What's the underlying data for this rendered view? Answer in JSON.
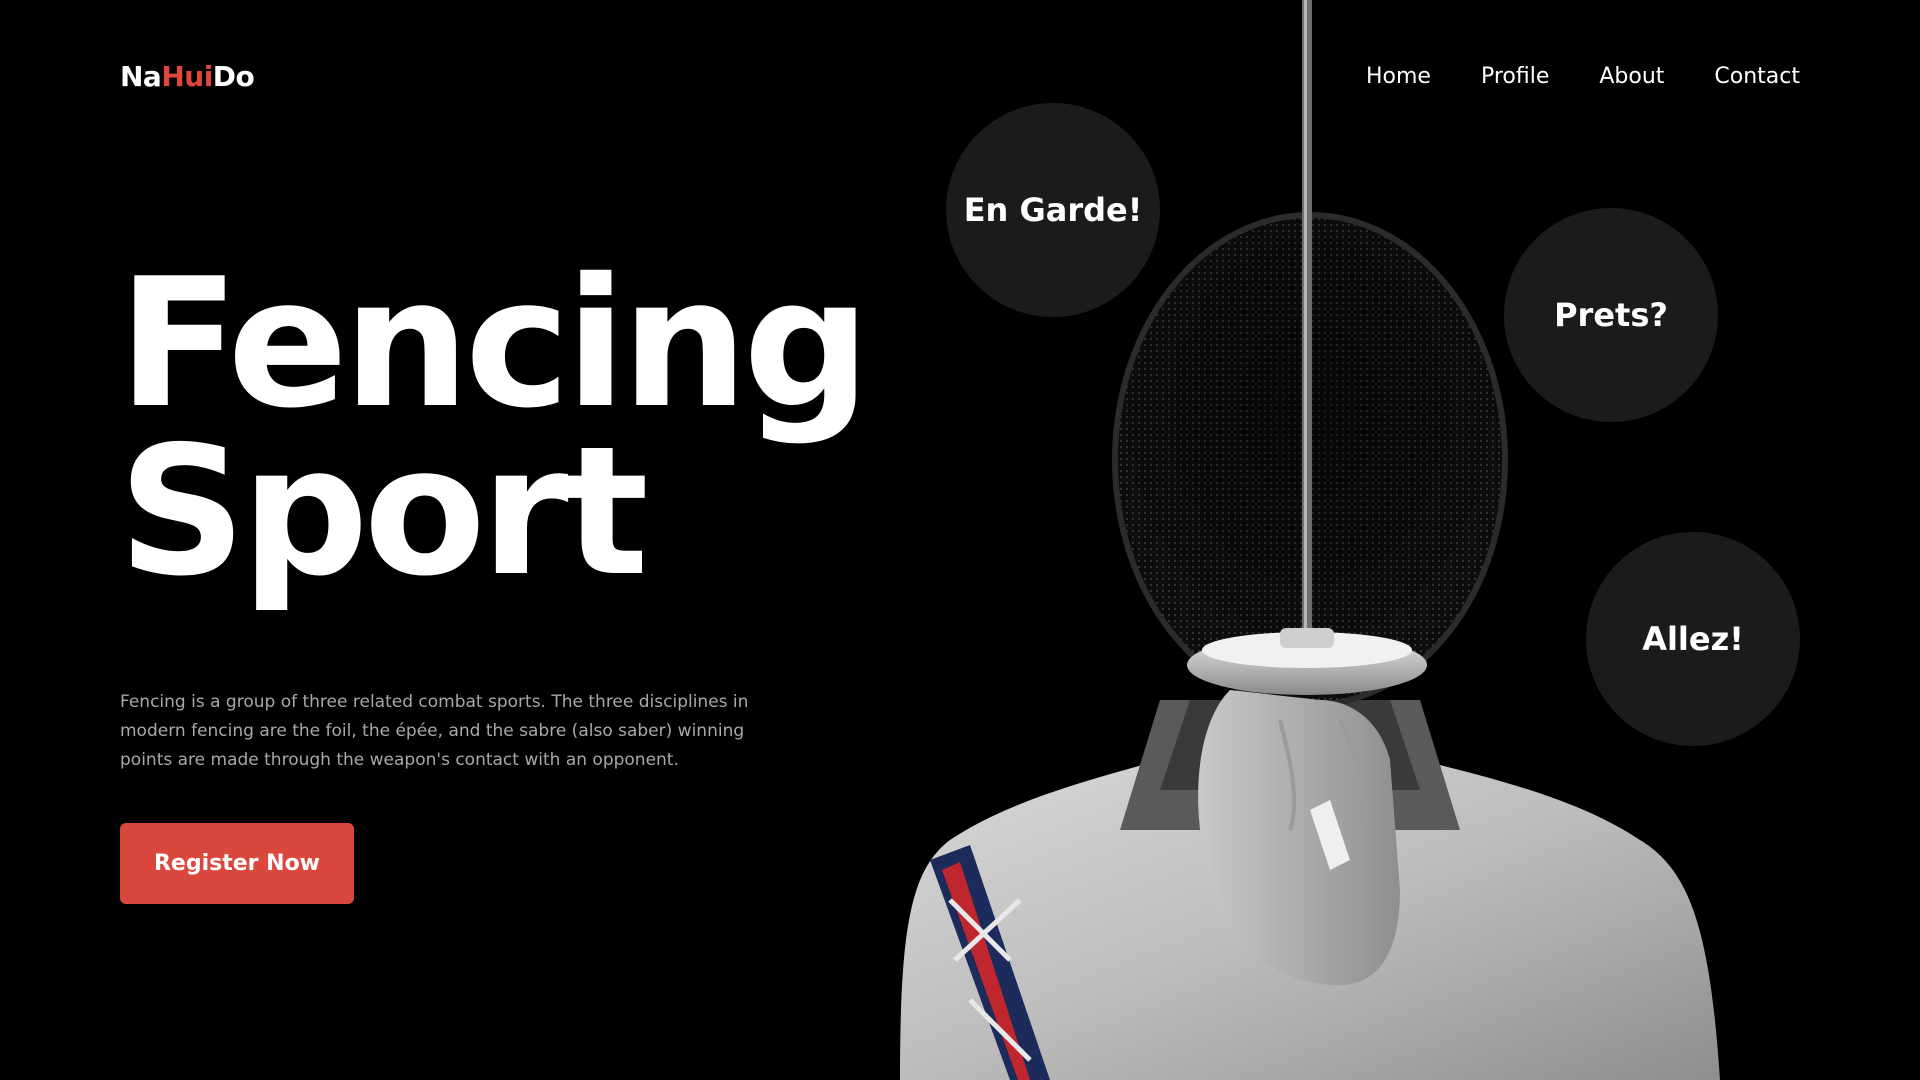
{
  "brand": {
    "part1": "Na",
    "part2": "Hui",
    "part3": "Do",
    "accent_color": "#e0473c"
  },
  "nav": {
    "items": [
      "Home",
      "Profile",
      "About",
      "Contact"
    ]
  },
  "hero": {
    "title_line1": "Fencing",
    "title_line2": "Sport",
    "description": "Fencing is a group of three related combat sports. The three disciplines in modern fencing are the foil, the épée, and the sabre (also saber) winning points are made through the weapon's contact with an opponent.",
    "cta_label": "Register Now",
    "cta_color": "#d9473d"
  },
  "bubbles": {
    "first": "En Garde!",
    "second": "Prets?",
    "third": "Allez!"
  }
}
